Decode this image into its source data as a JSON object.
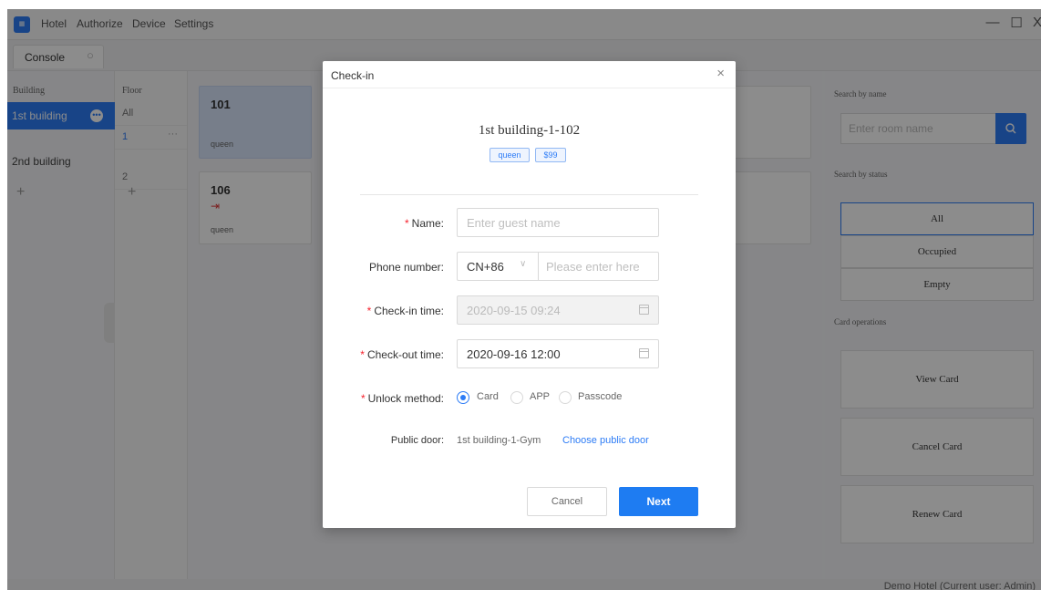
{
  "titlebar": {
    "menu": [
      "Hotel",
      "Authorize",
      "Device",
      "Settings"
    ],
    "window_controls": {
      "minimize": "—",
      "maximize": "☐",
      "close": "X"
    }
  },
  "tabs": [
    {
      "label": "Console"
    }
  ],
  "buildings": {
    "title": "Building",
    "items": [
      {
        "label": "1st building",
        "active": true
      },
      {
        "label": "2nd building",
        "active": false
      }
    ],
    "add_label": "+"
  },
  "floors": {
    "title": "Floor",
    "items": [
      {
        "label": "All",
        "active": false
      },
      {
        "label": "1",
        "active": true,
        "more": "···"
      },
      {
        "label": "2",
        "active": false
      }
    ],
    "add_label": "+"
  },
  "rooms": [
    {
      "number": "101",
      "type": "queen",
      "selected": true
    },
    {
      "number": "106",
      "type": "queen",
      "selected": false
    }
  ],
  "right_panel": {
    "search_by_name": "Search by name",
    "search_placeholder": "Enter room name",
    "search_by_status": "Search by status",
    "status_options": [
      {
        "label": "All",
        "active": true
      },
      {
        "label": "Occupied",
        "active": false
      },
      {
        "label": "Empty",
        "active": false
      }
    ],
    "card_operations": "Card operations",
    "card_buttons": [
      "View Card",
      "Cancel Card",
      "Renew Card"
    ]
  },
  "status_bar": {
    "text": "Demo Hotel   (Current user:  Admin)"
  },
  "modal": {
    "title": "Check-in",
    "close": "×",
    "room_title": "1st building-1-102",
    "tags": [
      "queen",
      "$99"
    ],
    "fields": {
      "name": {
        "label": "Name:",
        "required": true,
        "placeholder": "Enter guest name"
      },
      "phone": {
        "label": "Phone number:",
        "required": false,
        "country_code": "CN+86",
        "placeholder": "Please enter here"
      },
      "checkin": {
        "label": "Check-in time:",
        "required": true,
        "value": "2020-09-15 09:24",
        "disabled": true
      },
      "checkout": {
        "label": "Check-out time:",
        "required": true,
        "value": "2020-09-16 12:00"
      },
      "unlock": {
        "label": "Unlock method:",
        "required": true,
        "options": [
          "Card",
          "APP",
          "Passcode"
        ],
        "selected": "Card"
      },
      "public_door": {
        "label": "Public door:",
        "value": "1st building-1-Gym",
        "link": "Choose public door"
      }
    },
    "buttons": {
      "cancel": "Cancel",
      "next": "Next"
    }
  },
  "colors": {
    "primary": "#2d7cf6",
    "required": "#f5222d",
    "overlay": "rgba(0,0,0,0.45)"
  }
}
